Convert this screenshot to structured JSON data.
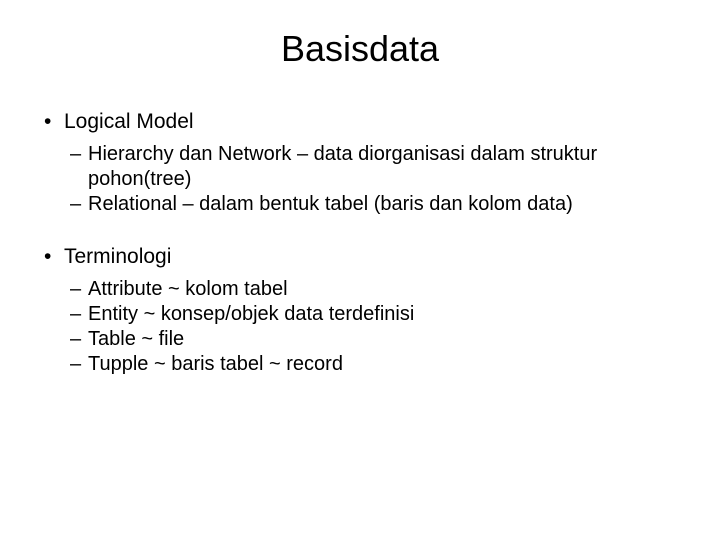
{
  "title": "Basisdata",
  "sections": [
    {
      "heading": "Logical Model",
      "items": [
        "Hierarchy dan Network – data diorganisasi dalam struktur pohon(tree)",
        "Relational – dalam bentuk tabel (baris dan kolom data)"
      ]
    },
    {
      "heading": "Terminologi",
      "items": [
        "Attribute ~ kolom tabel",
        "Entity ~ konsep/objek data terdefinisi",
        "Table ~ file",
        "Tupple ~ baris tabel ~ record"
      ]
    }
  ]
}
